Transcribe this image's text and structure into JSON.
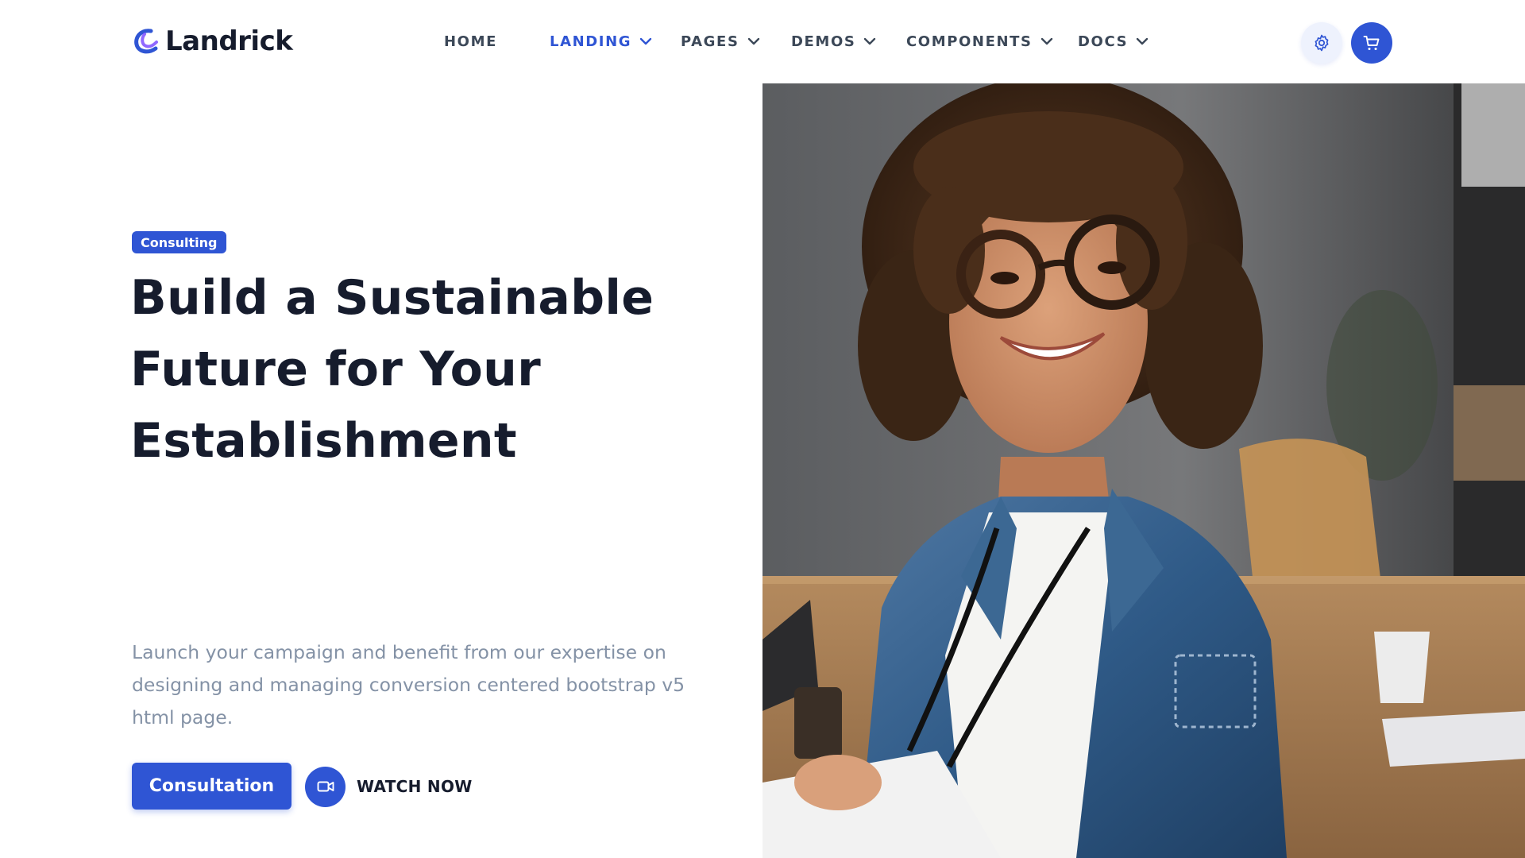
{
  "brand": {
    "name": "Landrick",
    "color": "#2f55d4"
  },
  "nav": [
    {
      "label": "HOME",
      "active": false,
      "dropdown": false
    },
    {
      "label": "LANDING",
      "active": true,
      "dropdown": true
    },
    {
      "label": "PAGES",
      "active": false,
      "dropdown": true
    },
    {
      "label": "DEMOS",
      "active": false,
      "dropdown": true
    },
    {
      "label": "COMPONENTS",
      "active": false,
      "dropdown": true
    },
    {
      "label": "DOCS",
      "active": false,
      "dropdown": true
    }
  ],
  "header_actions": {
    "settings_icon": "gear-icon",
    "cart_icon": "cart-icon"
  },
  "hero": {
    "badge": "Consulting",
    "title_lines": [
      "Build a Sustainable",
      "Future for Your",
      "Establishment"
    ],
    "description_lines": [
      "Launch your campaign and benefit from our expertise on",
      "designing and managing conversion centered bootstrap v5",
      "html page."
    ],
    "primary_button": "Consultation",
    "watch_label": "WATCH NOW",
    "watch_icon": "video-camera-icon",
    "image_alt": "smiling woman with glasses in denim jacket"
  },
  "colors": {
    "primary": "#2f55d4",
    "heading": "#161c2d",
    "muted": "#8492a6",
    "nav_text": "#3c4858"
  }
}
